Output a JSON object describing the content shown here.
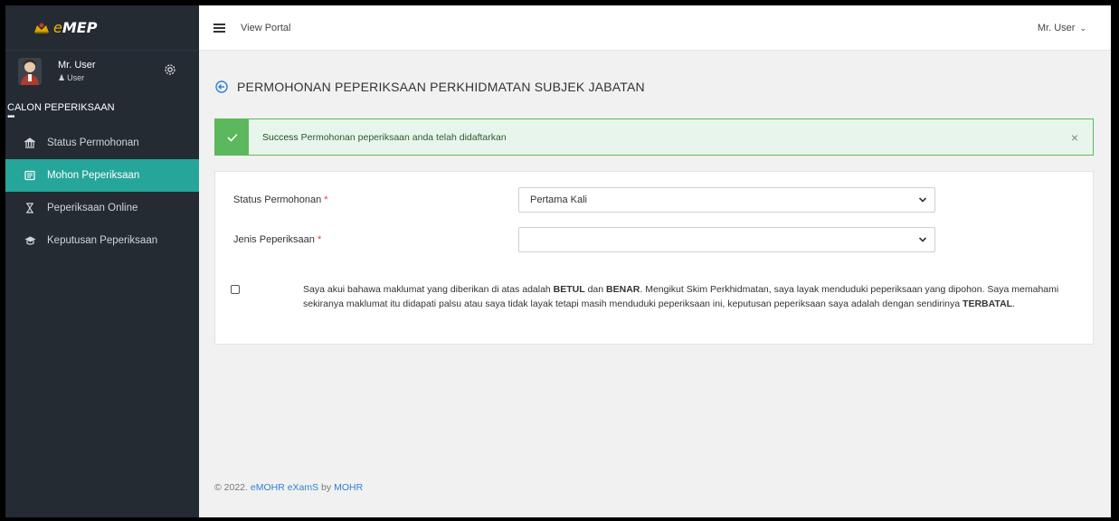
{
  "brand": {
    "prefix": "e",
    "name": "MEP"
  },
  "sidebar": {
    "user_name": "Mr. User",
    "user_role": "User",
    "section_header": "CALON PEPERIKSAAN",
    "dots": "•••",
    "items": [
      {
        "label": "Status Permohonan",
        "icon": "building-icon",
        "active": false
      },
      {
        "label": "Mohon Peperiksaan",
        "icon": "form-icon",
        "active": true
      },
      {
        "label": "Peperiksaan Online",
        "icon": "hourglass-icon",
        "active": false
      },
      {
        "label": "Keputusan Peperiksaan",
        "icon": "graduation-cap-icon",
        "active": false
      }
    ]
  },
  "topbar": {
    "view_portal": "View Portal",
    "user_menu": "Mr. User"
  },
  "page": {
    "title": "PERMOHONAN PEPERIKSAAN PERKHIDMATAN SUBJEK JABATAN"
  },
  "alert": {
    "strong": "Success",
    "message": " Permohonan peperiksaan anda telah didaftarkan",
    "close": "×"
  },
  "form": {
    "status_label": "Status Permohonan",
    "status_value": "Pertama Kali",
    "jenis_label": "Jenis Peperiksaan",
    "jenis_value": "",
    "required_mark": "*",
    "declaration": {
      "p1": "Saya akui bahawa maklumat yang diberikan di atas adalah ",
      "b1": "BETUL",
      "p2": " dan ",
      "b2": "BENAR",
      "p3": ". Mengikut Skim Perkhidmatan, saya layak menduduki peperiksaan yang dipohon. Saya memahami sekiranya maklumat itu didapati palsu atau saya tidak layak tetapi masih menduduki peperiksaan ini, keputusan peperiksaan saya adalah dengan sendirinya ",
      "b3": "TERBATAL",
      "p4": "."
    }
  },
  "footer": {
    "prefix": "© 2022. ",
    "product": "eMOHR eXamS",
    "by": " by ",
    "org": "MOHR"
  },
  "colors": {
    "sidebar_bg": "#242b33",
    "active_item": "#26a69a",
    "success": "#5cb85c",
    "link": "#2f7fd6"
  }
}
